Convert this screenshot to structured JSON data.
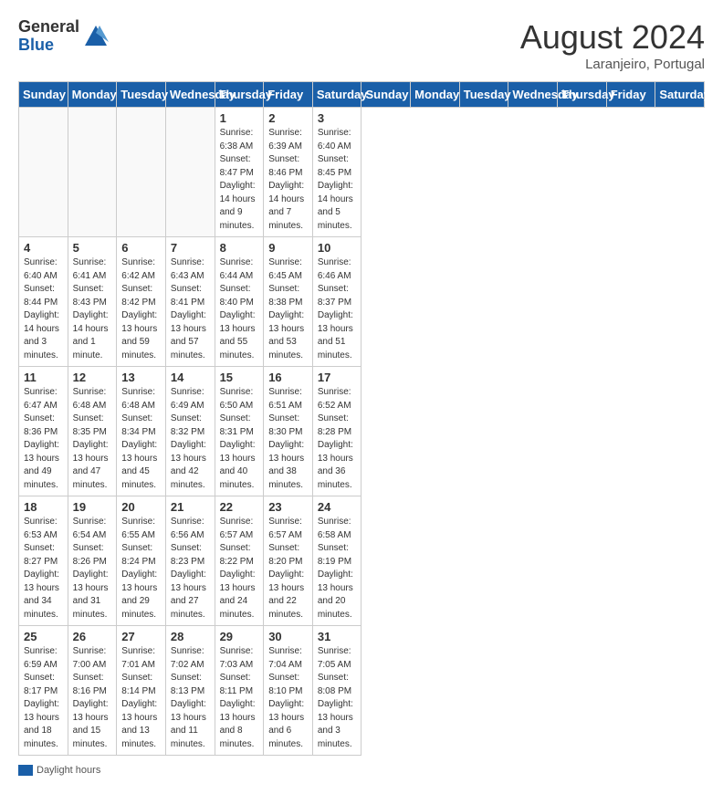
{
  "header": {
    "logo_general": "General",
    "logo_blue": "Blue",
    "month_title": "August 2024",
    "subtitle": "Laranjeiro, Portugal"
  },
  "days_of_week": [
    "Sunday",
    "Monday",
    "Tuesday",
    "Wednesday",
    "Thursday",
    "Friday",
    "Saturday"
  ],
  "weeks": [
    [
      {
        "day": "",
        "info": ""
      },
      {
        "day": "",
        "info": ""
      },
      {
        "day": "",
        "info": ""
      },
      {
        "day": "",
        "info": ""
      },
      {
        "day": "1",
        "info": "Sunrise: 6:38 AM\nSunset: 8:47 PM\nDaylight: 14 hours\nand 9 minutes."
      },
      {
        "day": "2",
        "info": "Sunrise: 6:39 AM\nSunset: 8:46 PM\nDaylight: 14 hours\nand 7 minutes."
      },
      {
        "day": "3",
        "info": "Sunrise: 6:40 AM\nSunset: 8:45 PM\nDaylight: 14 hours\nand 5 minutes."
      }
    ],
    [
      {
        "day": "4",
        "info": "Sunrise: 6:40 AM\nSunset: 8:44 PM\nDaylight: 14 hours\nand 3 minutes."
      },
      {
        "day": "5",
        "info": "Sunrise: 6:41 AM\nSunset: 8:43 PM\nDaylight: 14 hours\nand 1 minute."
      },
      {
        "day": "6",
        "info": "Sunrise: 6:42 AM\nSunset: 8:42 PM\nDaylight: 13 hours\nand 59 minutes."
      },
      {
        "day": "7",
        "info": "Sunrise: 6:43 AM\nSunset: 8:41 PM\nDaylight: 13 hours\nand 57 minutes."
      },
      {
        "day": "8",
        "info": "Sunrise: 6:44 AM\nSunset: 8:40 PM\nDaylight: 13 hours\nand 55 minutes."
      },
      {
        "day": "9",
        "info": "Sunrise: 6:45 AM\nSunset: 8:38 PM\nDaylight: 13 hours\nand 53 minutes."
      },
      {
        "day": "10",
        "info": "Sunrise: 6:46 AM\nSunset: 8:37 PM\nDaylight: 13 hours\nand 51 minutes."
      }
    ],
    [
      {
        "day": "11",
        "info": "Sunrise: 6:47 AM\nSunset: 8:36 PM\nDaylight: 13 hours\nand 49 minutes."
      },
      {
        "day": "12",
        "info": "Sunrise: 6:48 AM\nSunset: 8:35 PM\nDaylight: 13 hours\nand 47 minutes."
      },
      {
        "day": "13",
        "info": "Sunrise: 6:48 AM\nSunset: 8:34 PM\nDaylight: 13 hours\nand 45 minutes."
      },
      {
        "day": "14",
        "info": "Sunrise: 6:49 AM\nSunset: 8:32 PM\nDaylight: 13 hours\nand 42 minutes."
      },
      {
        "day": "15",
        "info": "Sunrise: 6:50 AM\nSunset: 8:31 PM\nDaylight: 13 hours\nand 40 minutes."
      },
      {
        "day": "16",
        "info": "Sunrise: 6:51 AM\nSunset: 8:30 PM\nDaylight: 13 hours\nand 38 minutes."
      },
      {
        "day": "17",
        "info": "Sunrise: 6:52 AM\nSunset: 8:28 PM\nDaylight: 13 hours\nand 36 minutes."
      }
    ],
    [
      {
        "day": "18",
        "info": "Sunrise: 6:53 AM\nSunset: 8:27 PM\nDaylight: 13 hours\nand 34 minutes."
      },
      {
        "day": "19",
        "info": "Sunrise: 6:54 AM\nSunset: 8:26 PM\nDaylight: 13 hours\nand 31 minutes."
      },
      {
        "day": "20",
        "info": "Sunrise: 6:55 AM\nSunset: 8:24 PM\nDaylight: 13 hours\nand 29 minutes."
      },
      {
        "day": "21",
        "info": "Sunrise: 6:56 AM\nSunset: 8:23 PM\nDaylight: 13 hours\nand 27 minutes."
      },
      {
        "day": "22",
        "info": "Sunrise: 6:57 AM\nSunset: 8:22 PM\nDaylight: 13 hours\nand 24 minutes."
      },
      {
        "day": "23",
        "info": "Sunrise: 6:57 AM\nSunset: 8:20 PM\nDaylight: 13 hours\nand 22 minutes."
      },
      {
        "day": "24",
        "info": "Sunrise: 6:58 AM\nSunset: 8:19 PM\nDaylight: 13 hours\nand 20 minutes."
      }
    ],
    [
      {
        "day": "25",
        "info": "Sunrise: 6:59 AM\nSunset: 8:17 PM\nDaylight: 13 hours\nand 18 minutes."
      },
      {
        "day": "26",
        "info": "Sunrise: 7:00 AM\nSunset: 8:16 PM\nDaylight: 13 hours\nand 15 minutes."
      },
      {
        "day": "27",
        "info": "Sunrise: 7:01 AM\nSunset: 8:14 PM\nDaylight: 13 hours\nand 13 minutes."
      },
      {
        "day": "28",
        "info": "Sunrise: 7:02 AM\nSunset: 8:13 PM\nDaylight: 13 hours\nand 11 minutes."
      },
      {
        "day": "29",
        "info": "Sunrise: 7:03 AM\nSunset: 8:11 PM\nDaylight: 13 hours\nand 8 minutes."
      },
      {
        "day": "30",
        "info": "Sunrise: 7:04 AM\nSunset: 8:10 PM\nDaylight: 13 hours\nand 6 minutes."
      },
      {
        "day": "31",
        "info": "Sunrise: 7:05 AM\nSunset: 8:08 PM\nDaylight: 13 hours\nand 3 minutes."
      }
    ]
  ],
  "footer": {
    "legend_label": "Daylight hours"
  }
}
